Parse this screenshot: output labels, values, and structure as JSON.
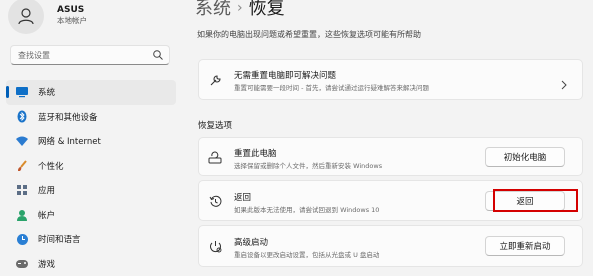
{
  "profile": {
    "name": "ASUS",
    "subtitle": "本地帐户"
  },
  "search": {
    "placeholder": "查找设置"
  },
  "sidebar": {
    "items": [
      {
        "label": "系统",
        "icon": "monitor-icon",
        "active": true
      },
      {
        "label": "蓝牙和其他设备",
        "icon": "bluetooth-icon"
      },
      {
        "label": "网络 & Internet",
        "icon": "wifi-icon"
      },
      {
        "label": "个性化",
        "icon": "brush-icon"
      },
      {
        "label": "应用",
        "icon": "apps-icon"
      },
      {
        "label": "帐户",
        "icon": "person-icon"
      },
      {
        "label": "时间和语言",
        "icon": "globe-clock-icon"
      },
      {
        "label": "游戏",
        "icon": "gamepad-icon"
      }
    ]
  },
  "header": {
    "root": "系统",
    "separator": "›",
    "current": "恢复"
  },
  "main": {
    "description": "如果你的电脑出现问题或希望重置，这些恢复选项可能有所帮助",
    "troubleshoot": {
      "title": "无需重置电脑即可解决问题",
      "subtitle": "重置可能需要一段时间 - 首先，请尝试通过运行疑难解答来解决问题"
    },
    "section_title": "恢复选项",
    "options": [
      {
        "title": "重置此电脑",
        "subtitle": "选择保留或删除个人文件，然后重新安装 Windows",
        "button": "初始化电脑",
        "icon": "reset-pc-icon"
      },
      {
        "title": "返回",
        "subtitle": "如果此版本无法使用，请尝试回退到 Windows 10",
        "button": "返回",
        "icon": "history-icon"
      },
      {
        "title": "高级启动",
        "subtitle": "重启设备以更改启动设置，包括从光盘或 U 盘启动",
        "button": "立即重新启动",
        "icon": "advanced-startup-icon"
      }
    ]
  },
  "colors": {
    "accent": "#005fb8",
    "highlight": "#d40000"
  }
}
